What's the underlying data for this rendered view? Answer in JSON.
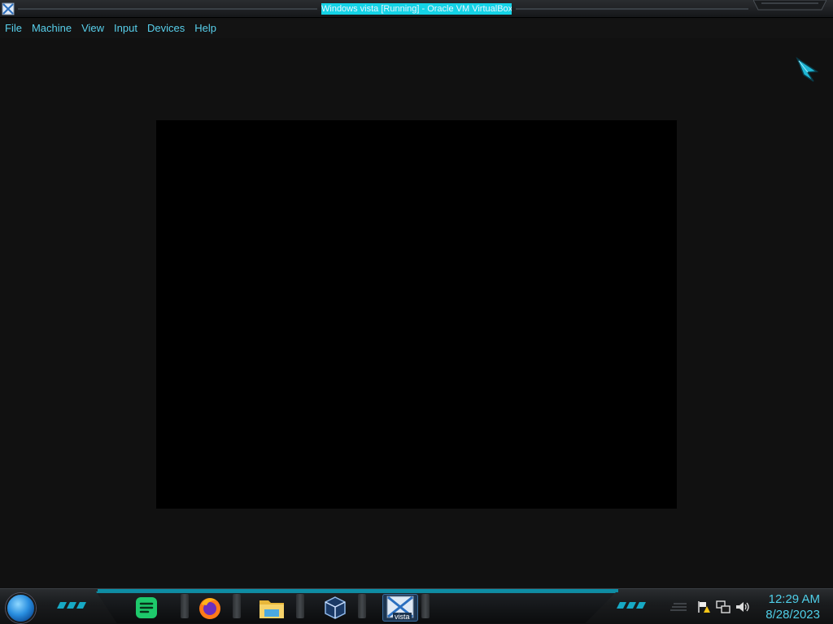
{
  "window": {
    "title": "Windows vista [Running] - Oracle VM VirtualBox",
    "app_icon": "virtualbox-icon"
  },
  "menu": {
    "items": [
      "File",
      "Machine",
      "View",
      "Input",
      "Devices",
      "Help"
    ]
  },
  "taskbar": {
    "start_icon": "windows-orb-icon",
    "apps": [
      {
        "name": "notes-app-icon"
      },
      {
        "name": "firefox-icon"
      },
      {
        "name": "file-explorer-icon"
      },
      {
        "name": "virtualbox-manager-icon"
      },
      {
        "name": "vista-vm-icon",
        "label": "vista"
      }
    ],
    "tray": [
      "action-center-flag-icon",
      "network-icon",
      "volume-icon"
    ],
    "clock": {
      "time": "12:29 AM",
      "date": "8/28/2023"
    }
  },
  "colors": {
    "accent": "#4fcfe8",
    "menu_text": "#58d0ec",
    "title_highlight": "#14d3e6"
  }
}
